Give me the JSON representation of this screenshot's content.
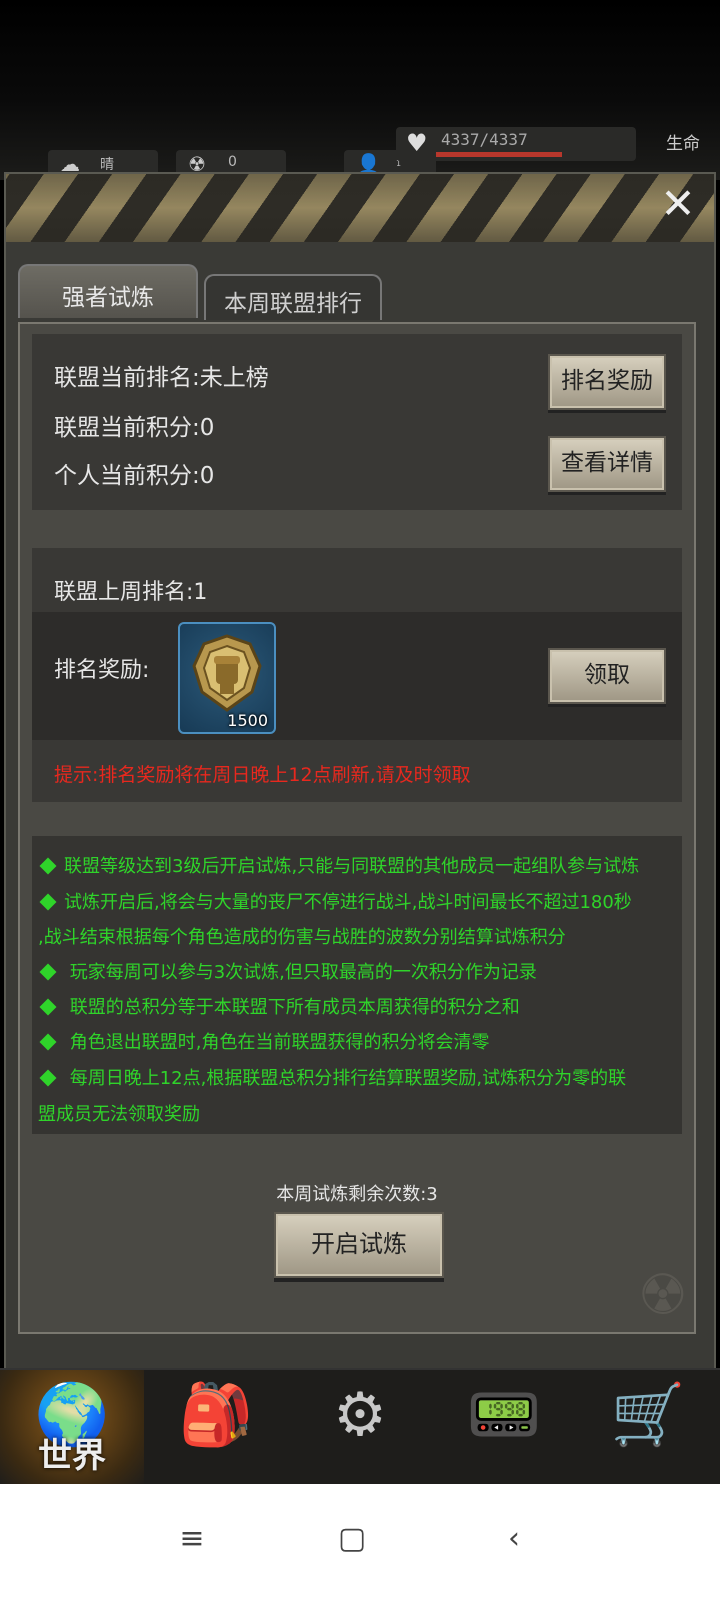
{
  "hud": {
    "weather_label": "晴",
    "radiation_value": "0",
    "players_value": "1",
    "hp": "4337/4337",
    "hp_fraction": 1.0,
    "hp_label": "生命"
  },
  "tabs": [
    {
      "label": "强者试炼",
      "active": true
    },
    {
      "label": "本周联盟排行",
      "active": false
    }
  ],
  "info": {
    "rank_line": "联盟当前排名:未上榜",
    "alliance_score_line": "联盟当前积分:0",
    "personal_score_line": "个人当前积分:0",
    "reward_button": "排名奖励",
    "details_button": "查看详情"
  },
  "last_week": {
    "rank_line": "联盟上周排名:1",
    "reward_label": "排名奖励:",
    "item_count": "1500",
    "item_icon": "alliance-badge-icon",
    "claim_button": "领取",
    "tip": "提示:排名奖励将在周日晚上12点刷新,请及时领取"
  },
  "rules": [
    "联盟等级达到3级后开启试炼,只能与同联盟的其他成员一起组队参与试炼",
    "试炼开启后,将会与大量的丧尸不停进行战斗,战斗时间最长不超过180秒",
    ",战斗结束根据每个角色造成的伤害与战胜的波数分别结算试炼积分",
    " 玩家每周可以参与3次试炼,但只取最高的一次积分作为记录",
    " 联盟的总积分等于本联盟下所有成员本周获得的积分之和",
    " 角色退出联盟时,角色在当前联盟获得的积分将会清零",
    " 每周日晚上12点,根据联盟总积分排行结算联盟奖励,试炼积分为零的联",
    "盟成员无法领取奖励"
  ],
  "remaining_text": "本周试炼剩余次数:3",
  "start_button": "开启试炼",
  "bottom_nav": [
    {
      "label": "世界",
      "icon": "globe-icon"
    },
    {
      "label": "",
      "icon": "backpack-icon"
    },
    {
      "label": "",
      "icon": "head-gears-icon"
    },
    {
      "label": "",
      "icon": "radio-icon"
    },
    {
      "label": "",
      "icon": "cart-icon"
    }
  ],
  "colors": {
    "rule_text": "#2fd42a",
    "tip_text": "#e8281e",
    "hp_fill": "#b8372c"
  }
}
